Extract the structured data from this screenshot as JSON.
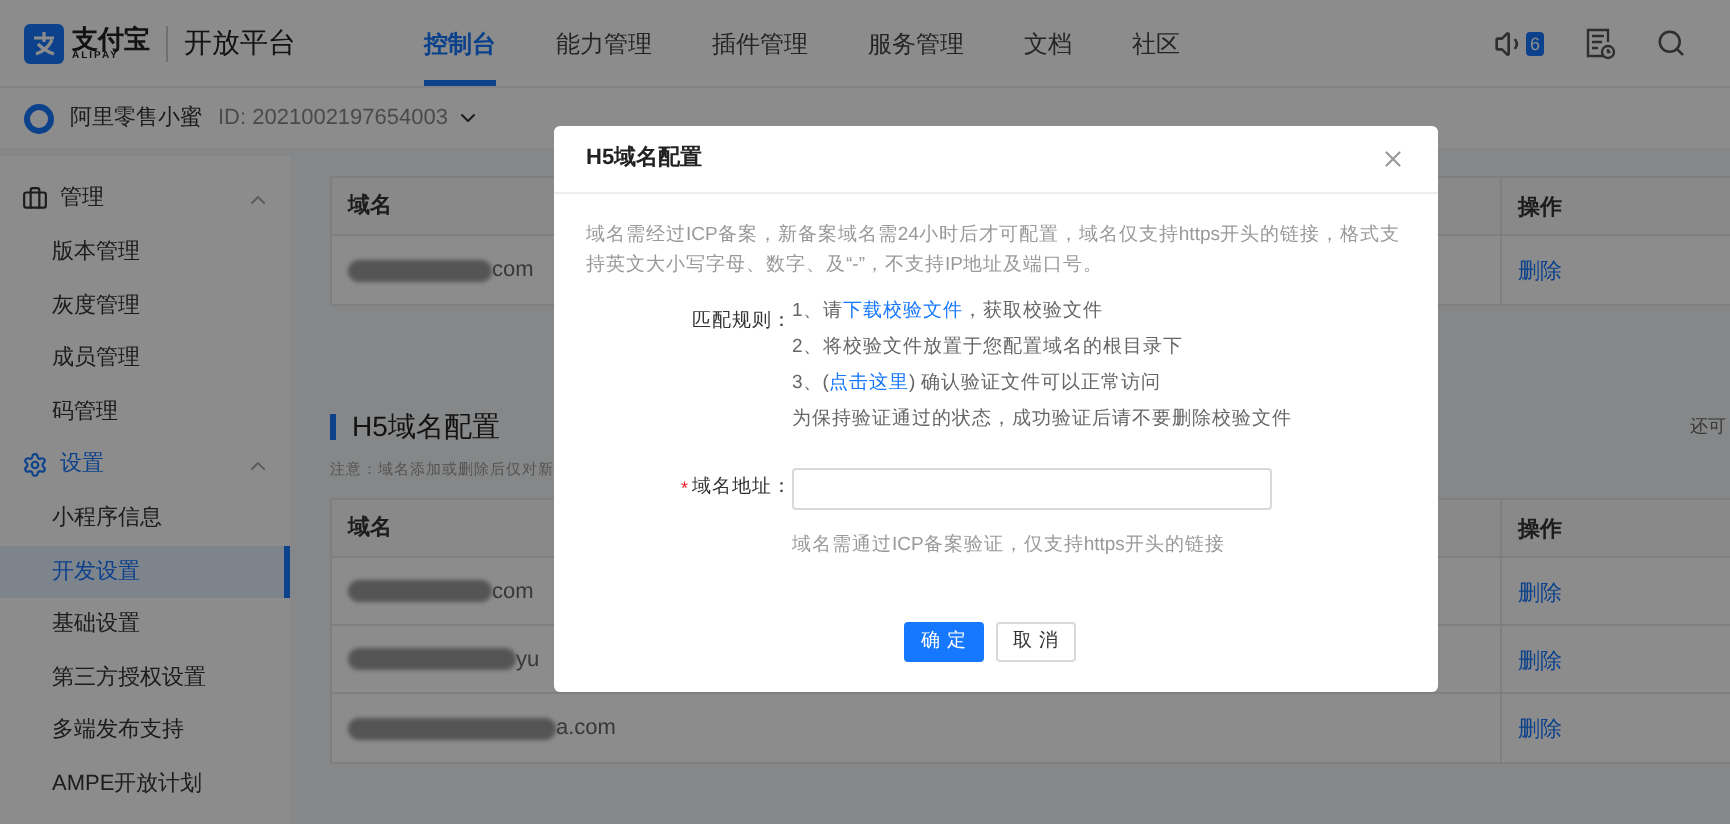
{
  "header": {
    "logo_text": "支付宝",
    "logo_subtext": "ALIPAY",
    "platform": "开放平台",
    "nav": [
      {
        "label": "控制台",
        "selected": true
      },
      {
        "label": "能力管理",
        "selected": false
      },
      {
        "label": "插件管理",
        "selected": false
      },
      {
        "label": "服务管理",
        "selected": false
      },
      {
        "label": "文档",
        "selected": false
      },
      {
        "label": "社区",
        "selected": false
      }
    ],
    "notification_count": "6"
  },
  "account": {
    "name": "阿里零售小蜜",
    "id": "ID: 2021002197654003"
  },
  "sidebar": {
    "groups": [
      {
        "label": "管理",
        "kind": "toolbox",
        "expanded": true,
        "items": [
          {
            "label": "版本管理",
            "selected": false
          },
          {
            "label": "灰度管理",
            "selected": false
          },
          {
            "label": "成员管理",
            "selected": false
          },
          {
            "label": "码管理",
            "selected": false
          }
        ]
      },
      {
        "label": "设置",
        "kind": "gear",
        "expanded": true,
        "items": [
          {
            "label": "小程序信息",
            "selected": false
          },
          {
            "label": "开发设置",
            "selected": true
          },
          {
            "label": "基础设置",
            "selected": false
          },
          {
            "label": "第三方授权设置",
            "selected": false
          },
          {
            "label": "多端发布支持",
            "selected": false
          },
          {
            "label": "AMPE开放计划",
            "selected": false
          }
        ]
      }
    ]
  },
  "top_table": {
    "columns": [
      "域名",
      "操作"
    ],
    "rows": [
      {
        "domain": "com",
        "action": "删除"
      }
    ]
  },
  "section": {
    "title": "H5域名配置",
    "note": "注意：域名添加或删除后仅对新",
    "side_note": "还可"
  },
  "h5_table": {
    "columns": [
      "域名",
      "操作"
    ],
    "rows": [
      {
        "domain": "com",
        "action": "删除"
      },
      {
        "domain": "yu",
        "action": "删除"
      },
      {
        "domain": "a.com",
        "action": "删除"
      }
    ]
  },
  "modal": {
    "title": "H5域名配置",
    "description": "域名需经过ICP备案，新备案域名需24小时后才可配置，域名仅支持https开头的链接，格式支持英文大小写字母、数字、及“-”，不支持IP地址及端口号。",
    "rules_label": "匹配规则：",
    "rules": [
      {
        "kind": "link",
        "before": "1、请",
        "link": "下载校验文件",
        "after": "，获取校验文件"
      },
      {
        "kind": "text",
        "text": "2、将校验文件放置于您配置域名的根目录下"
      },
      {
        "kind": "link",
        "before": "3、(",
        "link": "点击这里",
        "after": ") 确认验证文件可以正常访问"
      },
      {
        "kind": "text",
        "text": "为保持验证通过的状态，成功验证后请不要删除校验文件"
      }
    ],
    "field": {
      "label": "域名地址：",
      "required_mark": "*",
      "help": "域名需通过ICP备案验证，仅支持https开头的链接"
    },
    "buttons": [
      {
        "label": "确 定",
        "kind": "primary"
      },
      {
        "label": "取 消",
        "kind": "default"
      }
    ]
  }
}
